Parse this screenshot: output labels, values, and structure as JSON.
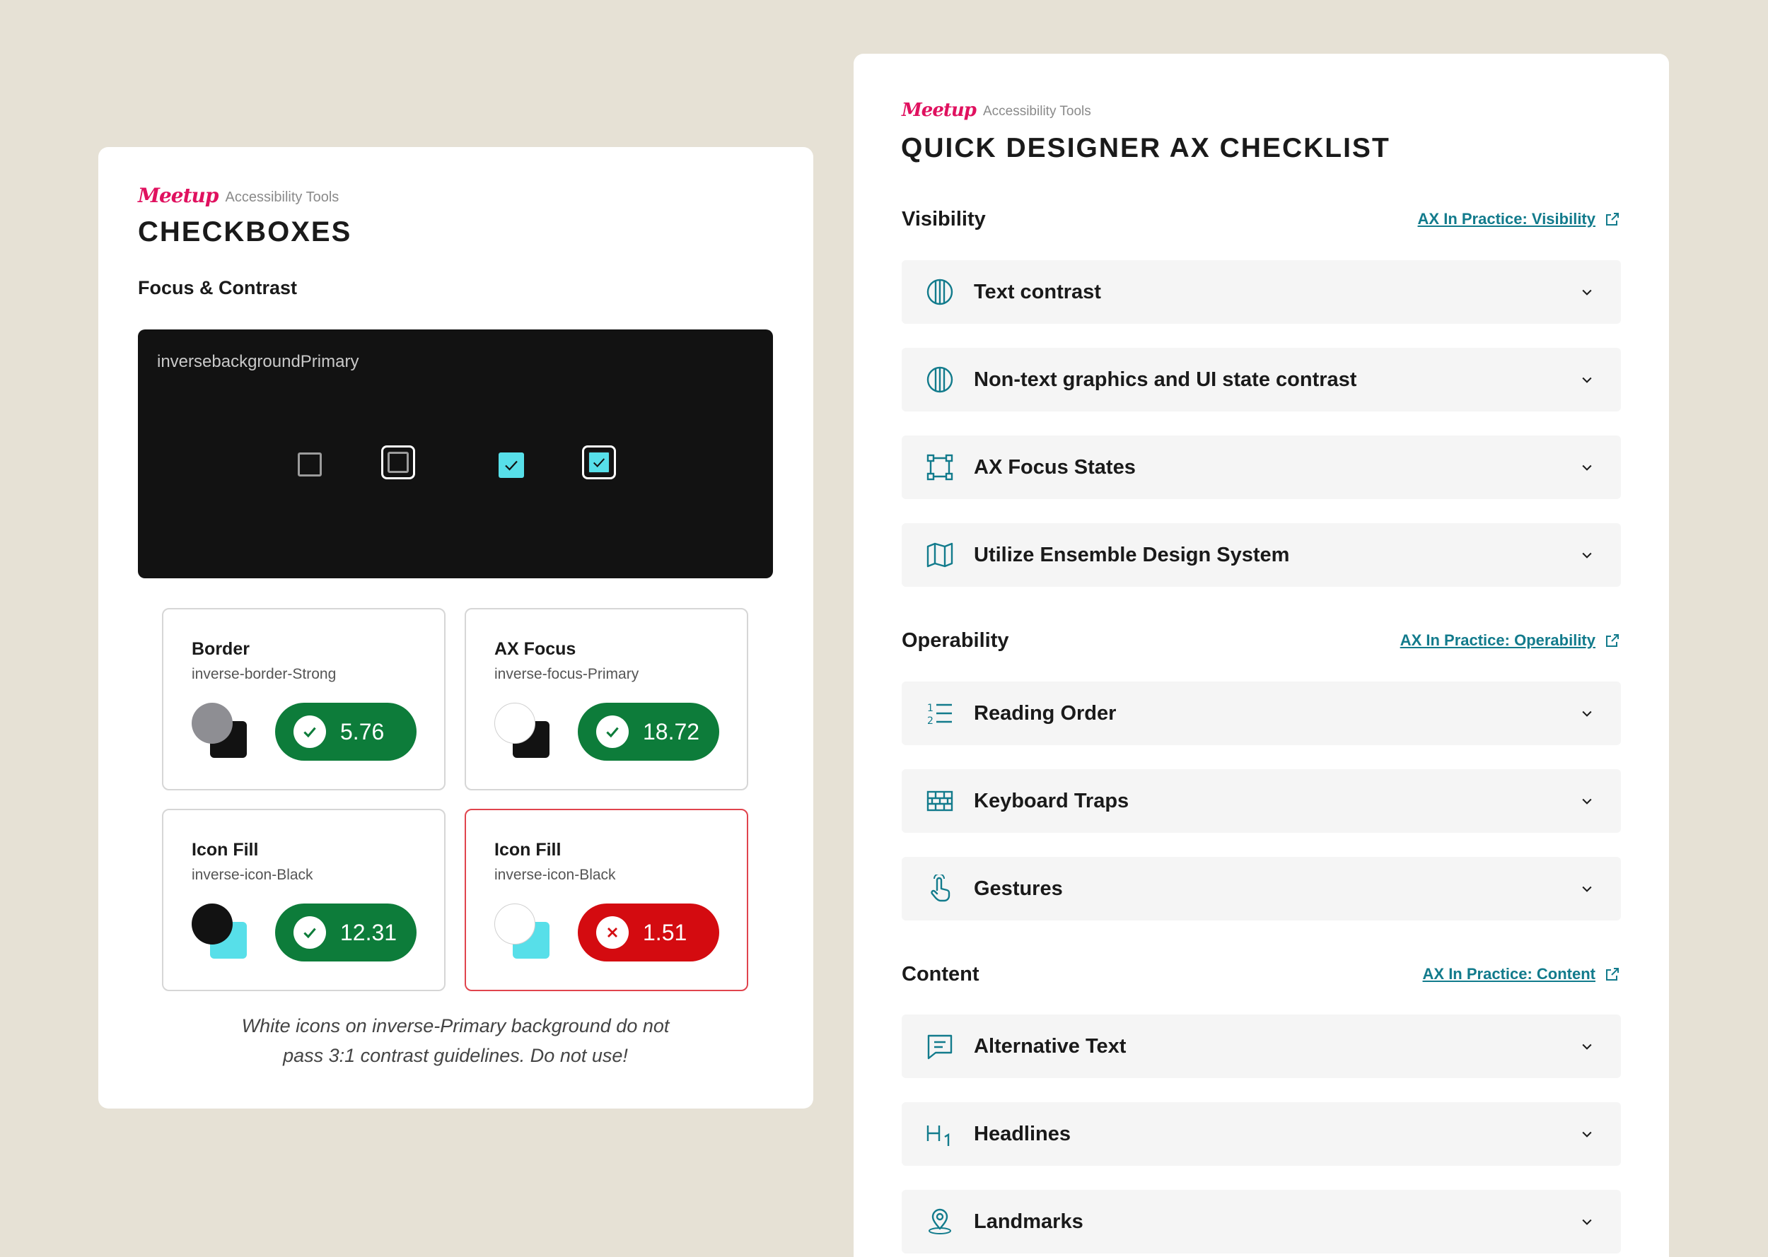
{
  "colors": {
    "background": "#e6e1d5",
    "brand": "#e0115f",
    "teal": "#127b8c",
    "pass": "#0d7c3a",
    "fail": "#d40b10",
    "cyan": "#57dfe9"
  },
  "left": {
    "brand_logo": "Meetup",
    "brand_sub": "Accessibility Tools",
    "title": "CHECKBOXES",
    "subtitle": "Focus & Contrast",
    "panel_label": "inversebackgroundPrimary",
    "tokens": [
      {
        "name": "Border",
        "token": "inverse-border-Strong",
        "ratio": "5.76",
        "status": "pass",
        "circle": "#8e8e93",
        "square": "#121212"
      },
      {
        "name": "AX Focus",
        "token": "inverse-focus-Primary",
        "ratio": "18.72",
        "status": "pass",
        "circle": "#ffffff",
        "square": "#121212"
      },
      {
        "name": "Icon Fill",
        "token": "inverse-icon-Black",
        "ratio": "12.31",
        "status": "pass",
        "circle": "#121212",
        "square": "#57dfe9"
      },
      {
        "name": "Icon Fill",
        "token": "inverse-icon-Black",
        "ratio": "1.51",
        "status": "fail",
        "circle": "#ffffff",
        "square": "#57dfe9"
      }
    ],
    "note_line1": "White icons on inverse-Primary background do not",
    "note_line2": "pass 3:1 contrast guidelines. Do not use!"
  },
  "right": {
    "brand_logo": "Meetup",
    "brand_sub": "Accessibility Tools",
    "title": "QUICK DESIGNER AX CHECKLIST",
    "sections": [
      {
        "title": "Visibility",
        "link": "AX In Practice: Visibility",
        "items": [
          {
            "label": "Text contrast",
            "icon": "contrast-icon"
          },
          {
            "label": "Non-text graphics and UI state contrast",
            "icon": "contrast-icon"
          },
          {
            "label": "AX Focus States",
            "icon": "focus-frame-icon"
          },
          {
            "label": "Utilize Ensemble Design System",
            "icon": "map-icon"
          }
        ]
      },
      {
        "title": "Operability",
        "link": "AX In Practice: Operability",
        "items": [
          {
            "label": "Reading Order",
            "icon": "ordered-list-icon"
          },
          {
            "label": "Keyboard Traps",
            "icon": "brick-wall-icon"
          },
          {
            "label": "Gestures",
            "icon": "hand-pointer-icon"
          }
        ]
      },
      {
        "title": "Content",
        "link": "AX In Practice: Content",
        "items": [
          {
            "label": "Alternative Text",
            "icon": "message-icon"
          },
          {
            "label": "Headlines",
            "icon": "heading-icon"
          },
          {
            "label": "Landmarks",
            "icon": "location-pin-icon"
          }
        ]
      }
    ]
  }
}
